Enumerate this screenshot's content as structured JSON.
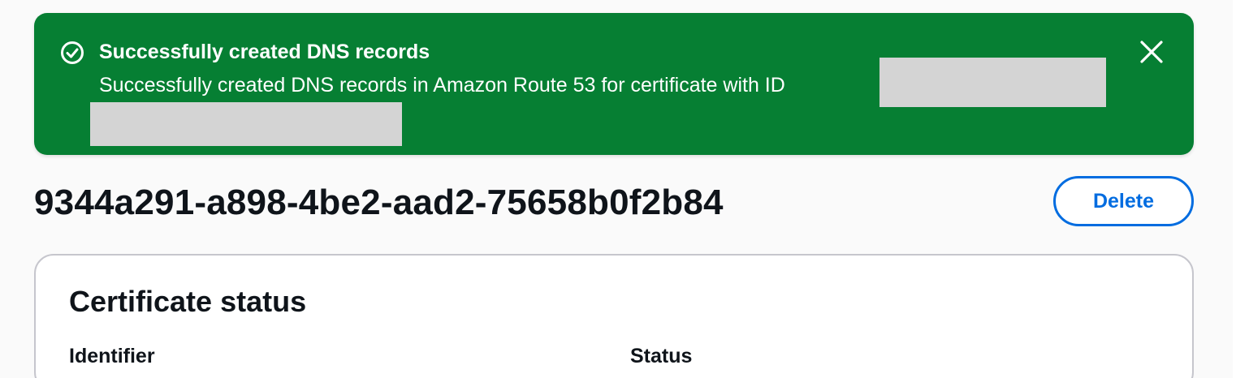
{
  "flash": {
    "type": "success",
    "icon": "check-circle-icon",
    "title": "Successfully created DNS records",
    "message": "Successfully created DNS records in Amazon Route 53 for certificate with ID",
    "dismiss_icon": "close-icon",
    "background_color": "#067f33"
  },
  "header": {
    "title": "9344a291-a898-4be2-aad2-75658b0f2b84",
    "delete_label": "Delete",
    "accent_color": "#006ce0"
  },
  "certificate_status": {
    "title": "Certificate status",
    "fields": [
      {
        "label": "Identifier"
      },
      {
        "label": "Status"
      }
    ]
  }
}
